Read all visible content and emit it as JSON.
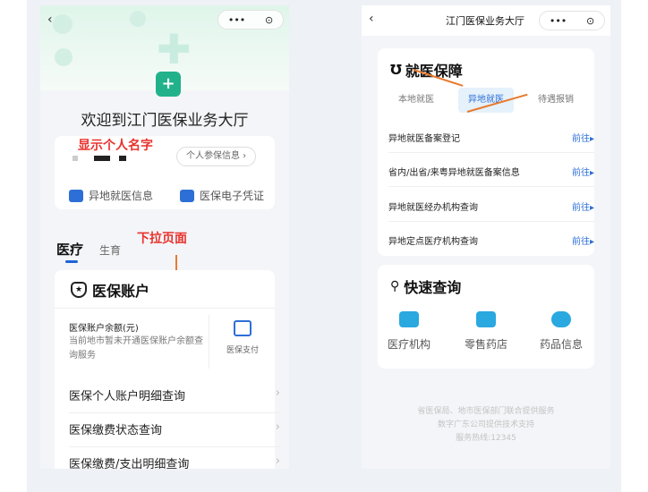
{
  "left_phone": {
    "welcome_title": "欢迎到江门医保业务大厅",
    "annotation_name": "显示个人名字",
    "insurance_info_button": "个人参保信息",
    "quick_links": [
      {
        "label": "异地就医信息",
        "icon": "card-location-icon",
        "color": "#2d6fd6"
      },
      {
        "label": "医保电子凭证",
        "icon": "id-card-icon",
        "color": "#2d6fd6"
      }
    ],
    "tabs": [
      "医疗",
      "生育"
    ],
    "annotation_scroll": "下拉页面",
    "section_title": "医保账户",
    "balance_label": "医保账户余额(元)",
    "balance_note": "当前地市暂未开通医保账户余额查询服务",
    "pay_label": "医保支付",
    "list_items": [
      "医保个人账户明细查询",
      "医保缴费状态查询",
      "医保缴费/支出明细查询"
    ]
  },
  "right_phone": {
    "title": "江门医保业务大厅",
    "section_title": "就医保障",
    "tabs": [
      "本地就医",
      "异地就医",
      "待遇报销"
    ],
    "active_tab": "异地就医",
    "rows": [
      {
        "label": "异地就医备案登记",
        "action": "前往"
      },
      {
        "label": "省内/出省/来粤异地就医备案信息",
        "action": "前往"
      },
      {
        "label": "异地就医经办机构查询",
        "action": "前往"
      },
      {
        "label": "异地定点医疗机构查询",
        "action": "前往"
      }
    ],
    "quick_title": "快速查询",
    "quick_items": [
      {
        "label": "医疗机构",
        "icon": "hospital-icon",
        "color": "#2aa8e0"
      },
      {
        "label": "零售药店",
        "icon": "pharmacy-icon",
        "color": "#2aa8e0"
      },
      {
        "label": "药品信息",
        "icon": "pill-icon",
        "color": "#2aa8e0"
      }
    ],
    "footer": [
      "省医保局、地市医保部门联合提供服务",
      "数字广东公司提供技术支持",
      "服务热线:12345"
    ]
  },
  "colors": {
    "accent_blue": "#2d6fd6",
    "annotation_red": "#e8322c",
    "arrow_orange": "#e87a2d",
    "brand_green": "#21b28b"
  }
}
